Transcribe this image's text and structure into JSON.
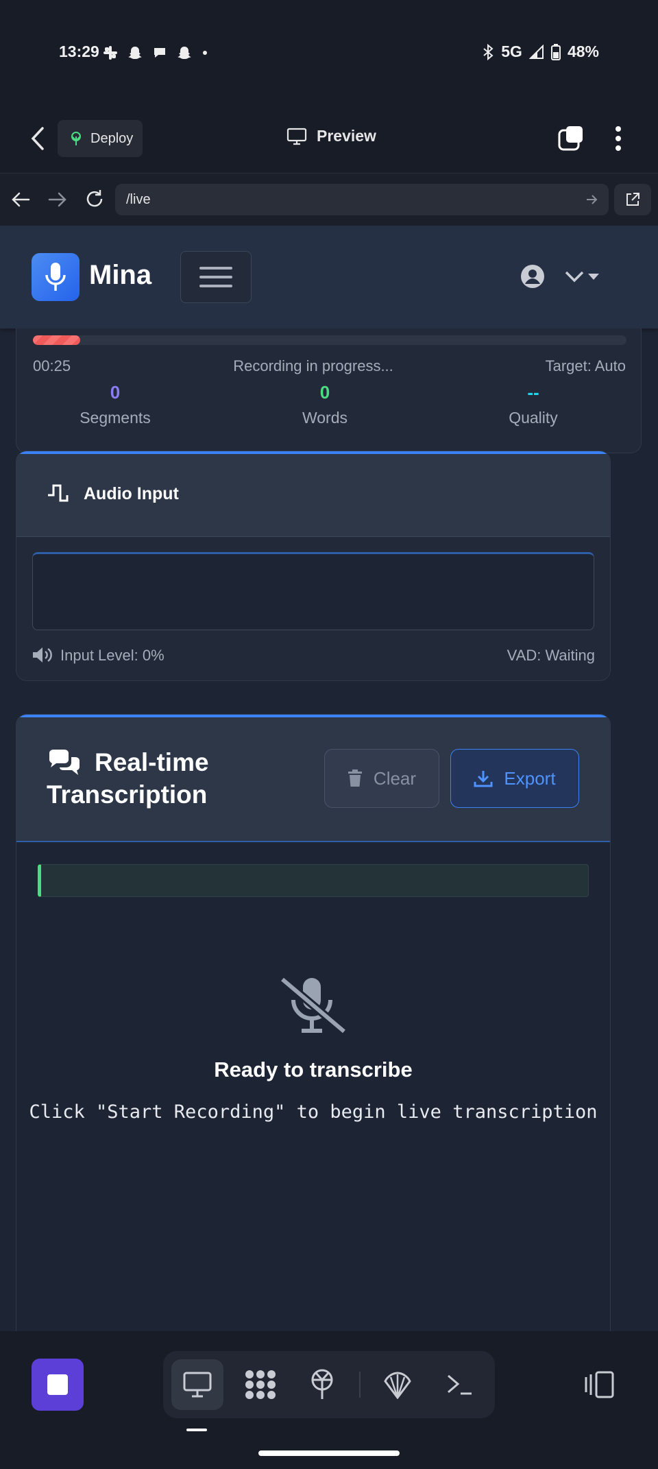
{
  "status_bar": {
    "time": "13:29",
    "network": "5G",
    "battery": "48%"
  },
  "app_bar": {
    "deploy_label": "Deploy",
    "preview_label": "Preview"
  },
  "browser": {
    "url": "/live"
  },
  "navbar": {
    "brand": "Mina"
  },
  "recording": {
    "elapsed": "00:25",
    "status": "Recording in progress...",
    "target": "Target: Auto",
    "progress_fraction": 0.08,
    "stats": [
      {
        "value": "0",
        "label": "Segments",
        "color": "#8b7cf6"
      },
      {
        "value": "0",
        "label": "Words",
        "color": "#4ade80"
      },
      {
        "value": "--",
        "label": "Quality",
        "color": "#22d3ee"
      }
    ]
  },
  "audio_input": {
    "title": "Audio Input",
    "level": "Input Level: 0%",
    "vad": "VAD: Waiting"
  },
  "transcription": {
    "title_line1": "Real-time",
    "title_line2": "Transcription",
    "clear_label": "Clear",
    "export_label": "Export",
    "empty_title": "Ready to transcribe",
    "empty_subtitle": "Click \"Start Recording\" to begin live transcription"
  },
  "colors": {
    "accent": "#3b82f6",
    "stop_button": "#5b3fd6",
    "progress": "#f87171"
  },
  "bottom_nav": {
    "items": [
      "desktop-icon",
      "apps-icon",
      "deploy-icon",
      "shell-icon",
      "terminal-icon"
    ]
  }
}
